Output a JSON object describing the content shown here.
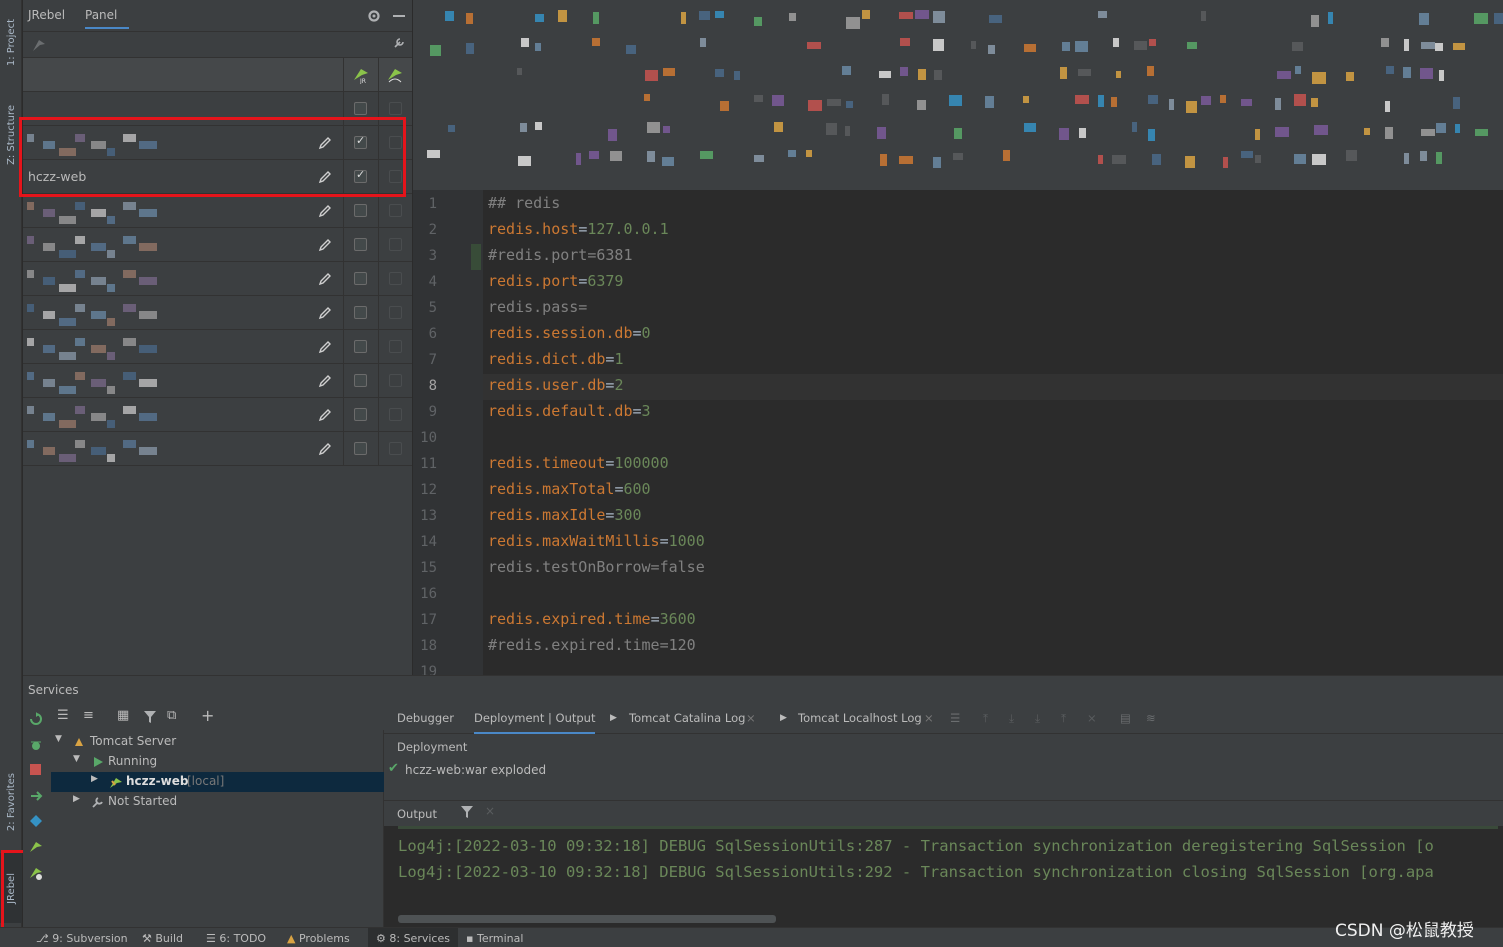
{
  "left_strip": {
    "project": "1: Project",
    "structure": "Z: Structure",
    "favorites": "2: Favorites",
    "jrebel": "JRebel"
  },
  "jrebel_panel": {
    "tab_jrebel": "JRebel",
    "tab_panel": "Panel",
    "modules": [
      {
        "name": "",
        "jr_checked": false
      },
      {
        "name": "",
        "jr_checked": true
      },
      {
        "name": "hczz-web",
        "jr_checked": true
      },
      {
        "name": "",
        "jr_checked": false
      },
      {
        "name": "",
        "jr_checked": false
      },
      {
        "name": "",
        "jr_checked": false
      },
      {
        "name": "",
        "jr_checked": false
      },
      {
        "name": "",
        "jr_checked": false
      },
      {
        "name": "",
        "jr_checked": false
      },
      {
        "name": "",
        "jr_checked": false
      },
      {
        "name": "",
        "jr_checked": false
      }
    ]
  },
  "editor": {
    "lines": [
      {
        "n": "1",
        "key": "## redis",
        "val": "",
        "comment": true
      },
      {
        "n": "2",
        "key": "redis.host",
        "val": "127.0.0.1",
        "comment": false
      },
      {
        "n": "3",
        "key": "#redis.port=6381",
        "val": "",
        "comment": true
      },
      {
        "n": "4",
        "key": "redis.port",
        "val": "6379",
        "comment": false
      },
      {
        "n": "5",
        "key": "redis.pass=",
        "val": "",
        "comment": true
      },
      {
        "n": "6",
        "key": "redis.session.db",
        "val": "0",
        "comment": false
      },
      {
        "n": "7",
        "key": "redis.dict.db",
        "val": "1",
        "comment": false
      },
      {
        "n": "8",
        "key": "redis.user.db",
        "val": "2",
        "comment": false
      },
      {
        "n": "9",
        "key": "redis.default.db",
        "val": "3",
        "comment": false
      },
      {
        "n": "10",
        "key": "",
        "val": "",
        "comment": false
      },
      {
        "n": "11",
        "key": "redis.timeout",
        "val": "100000",
        "comment": false
      },
      {
        "n": "12",
        "key": "redis.maxTotal",
        "val": "600",
        "comment": false
      },
      {
        "n": "13",
        "key": "redis.maxIdle",
        "val": "300",
        "comment": false
      },
      {
        "n": "14",
        "key": "redis.maxWaitMillis",
        "val": "1000",
        "comment": false
      },
      {
        "n": "15",
        "key": "redis.testOnBorrow=false",
        "val": "",
        "comment": true
      },
      {
        "n": "16",
        "key": "",
        "val": "",
        "comment": false
      },
      {
        "n": "17",
        "key": "redis.expired.time",
        "val": "3600",
        "comment": false
      },
      {
        "n": "18",
        "key": "#redis.expired.time=120",
        "val": "",
        "comment": true
      },
      {
        "n": "19",
        "key": "",
        "val": "",
        "comment": false
      }
    ]
  },
  "services": {
    "title": "Services",
    "tree": {
      "server": "Tomcat Server",
      "running": "Running",
      "app_name": "hczz-web",
      "app_tag": "[local]",
      "not_started": "Not Started"
    },
    "tabs": {
      "debugger": "Debugger",
      "deployment_output": "Deployment | Output",
      "catalina_log": "Tomcat Catalina Log",
      "localhost_log": "Tomcat Localhost Log"
    },
    "deployment_label": "Deployment",
    "artifact": "hczz-web:war exploded",
    "output_label": "Output",
    "logs": [
      "Log4j:[2022-03-10 09:32:18] DEBUG SqlSessionUtils:287 - Transaction synchronization deregistering SqlSession [o",
      "Log4j:[2022-03-10 09:32:18] DEBUG SqlSessionUtils:292 - Transaction synchronization closing SqlSession [org.apa"
    ]
  },
  "statusbar": {
    "subversion": "9: Subversion",
    "build": "Build",
    "todo": "6: TODO",
    "problems": "Problems",
    "services": "8: Services",
    "terminal": "Terminal",
    "watermark": "CSDN @松鼠教授"
  }
}
